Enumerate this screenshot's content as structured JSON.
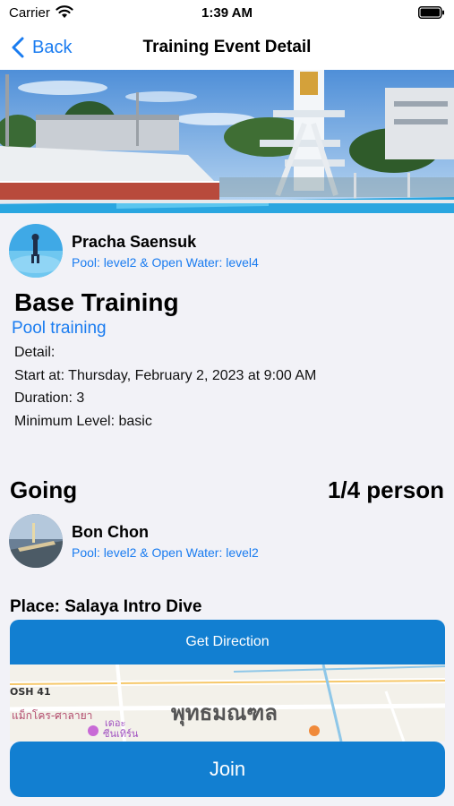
{
  "status_bar": {
    "carrier": "Carrier",
    "time": "1:39 AM"
  },
  "nav": {
    "back_label": "Back",
    "title": "Training Event Detail"
  },
  "host": {
    "name": "Pracha Saensuk",
    "level": "Pool: level2 & Open Water: level4"
  },
  "event": {
    "title": "Base Training",
    "type": "Pool training",
    "detail": "Detail:",
    "start_at": "Start at: Thursday, February 2, 2023 at 9:00 AM",
    "duration": "Duration: 3",
    "minimum_level": "Minimum Level: basic"
  },
  "going": {
    "heading": "Going",
    "count": "1/4 person",
    "attendees": [
      {
        "name": "Bon Chon",
        "level": "Pool: level2 & Open Water: level2"
      }
    ]
  },
  "place": {
    "label": "Place: Salaya Intro Dive",
    "direction_button": "Get Direction",
    "map_labels": {
      "road": "OSH 41",
      "district": "พุทธมณฑล",
      "area": "แม็กโคร-ศาลายา",
      "poi": "เดอะ",
      "poi2": "ซีนเทิร์น"
    }
  },
  "join_button": "Join",
  "colors": {
    "accent": "#1a7cf0",
    "button": "#127fd1",
    "background": "#f2f2f7"
  }
}
